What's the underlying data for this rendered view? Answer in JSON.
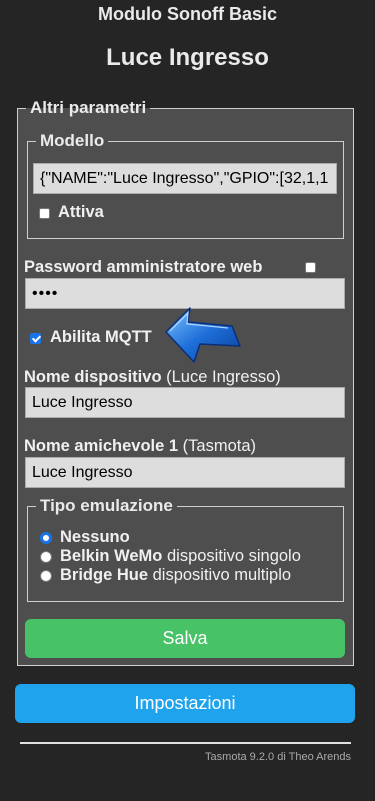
{
  "header": {
    "module_title": "Modulo Sonoff Basic",
    "device_title": "Luce Ingresso"
  },
  "other_params": {
    "legend": "Altri parametri",
    "model": {
      "legend": "Modello",
      "template_value": "{\"NAME\":\"Luce Ingresso\",\"GPIO\":[32,1,1",
      "activate_label": "Attiva",
      "activate_checked": false
    },
    "web_password": {
      "label": "Password amministratore web",
      "value": "••••",
      "show_checked": false
    },
    "mqtt": {
      "label": "Abilita MQTT",
      "checked": true
    },
    "device_name": {
      "label": "Nome dispositivo",
      "hint": "(Luce Ingresso)",
      "value": "Luce Ingresso"
    },
    "friendly_name": {
      "label": "Nome amichevole 1",
      "hint": "(Tasmota)",
      "value": "Luce Ingresso"
    },
    "emulation": {
      "legend": "Tipo emulazione",
      "options": [
        {
          "bold": "Nessuno",
          "rest": "",
          "selected": true
        },
        {
          "bold": "Belkin WeMo",
          "rest": " dispositivo singolo",
          "selected": false
        },
        {
          "bold": "Bridge Hue",
          "rest": " dispositivo multiplo",
          "selected": false
        }
      ]
    },
    "save_label": "Salva"
  },
  "settings_label": "Impostazioni",
  "footer": "Tasmota 9.2.0 di Theo Arends",
  "colors": {
    "background": "#252525",
    "fieldset_bg": "#4e4e4e",
    "save_button": "#47c266",
    "settings_button": "#1fa3ec",
    "accent": "#1a73e8",
    "cursor": "#1e6fd9"
  },
  "icons": {
    "pointer": "mouse-pointer-icon"
  }
}
